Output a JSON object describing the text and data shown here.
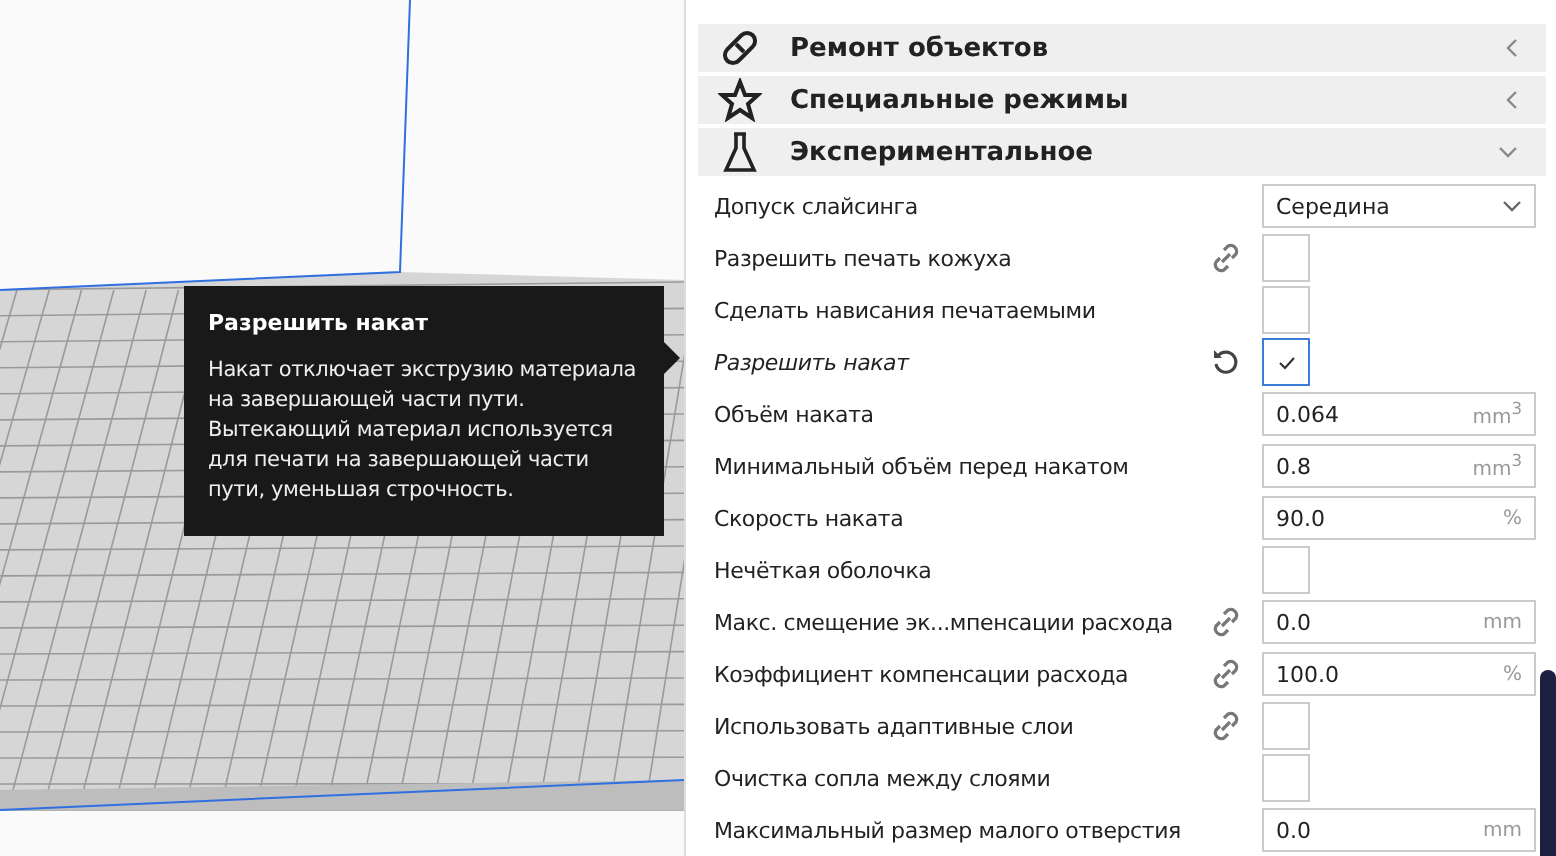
{
  "tooltip": {
    "title": "Разрешить накат",
    "text": "Накат отключает экструзию материала на завершающей части пути. Вытекающий материал используется для печати на завершающей части пути, уменьшая строчность."
  },
  "categories": [
    {
      "kind": "bandage",
      "label": "Ремонт объектов",
      "expanded": false
    },
    {
      "kind": "star",
      "label": "Специальные режимы",
      "expanded": false
    },
    {
      "kind": "flask",
      "label": "Экспериментальное",
      "expanded": true
    }
  ],
  "settings": [
    {
      "kind": "dropdown",
      "label": "Допуск слайсинга",
      "modified": false,
      "value": "Середина"
    },
    {
      "kind": "checkbox",
      "label": "Разрешить печать кожуха",
      "modified": false,
      "linked": true,
      "checked": false
    },
    {
      "kind": "checkbox",
      "label": "Сделать нависания печатаемыми",
      "modified": false,
      "checked": false
    },
    {
      "kind": "checkbox",
      "label": "Разрешить накат",
      "modified": true,
      "resettable": true,
      "checked": true
    },
    {
      "kind": "number",
      "label": "Объём наката",
      "modified": false,
      "value": "0.064",
      "unit": "mm$^{3}$"
    },
    {
      "kind": "number",
      "label": "Минимальный объём перед накатом",
      "modified": false,
      "value": "0.8",
      "unit": "mm$^{3}$"
    },
    {
      "kind": "number",
      "label": "Скорость наката",
      "modified": false,
      "value": "90.0",
      "unit": "%"
    },
    {
      "kind": "checkbox",
      "label": "Нечёткая оболочка",
      "modified": false,
      "checked": false
    },
    {
      "kind": "number",
      "label": "Макс. смещение эк...мпенсации расхода",
      "modified": false,
      "linked": true,
      "value": "0.0",
      "unit": "mm"
    },
    {
      "kind": "number",
      "label": "Коэффициент компенсации расхода",
      "modified": false,
      "linked": true,
      "value": "100.0",
      "unit": "%"
    },
    {
      "kind": "checkbox",
      "label": "Использовать адаптивные слои",
      "modified": false,
      "linked": true,
      "checked": false
    },
    {
      "kind": "checkbox",
      "label": "Очистка сопла между слоями",
      "modified": false,
      "checked": false
    },
    {
      "kind": "number",
      "label": "Максимальный размер малого отверстия",
      "modified": false,
      "value": "0.0",
      "unit": "mm"
    }
  ]
}
